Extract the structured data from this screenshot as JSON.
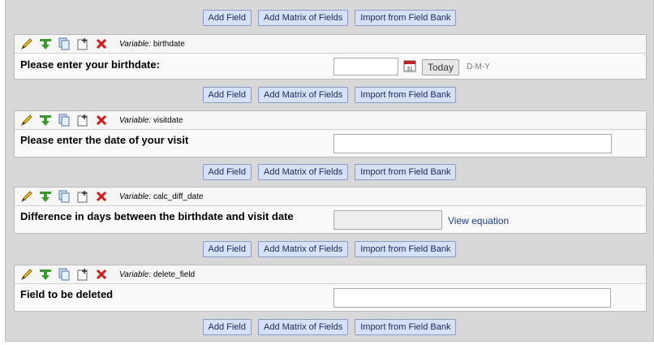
{
  "buttons": {
    "add_field": "Add Field",
    "add_matrix": "Add Matrix of Fields",
    "import_bank": "Import from Field Bank"
  },
  "variable_prefix": "Variable:",
  "fields": [
    {
      "variable": "birthdate",
      "question": "Please enter your birthdate:",
      "today_label": "Today",
      "date_format": "D-M-Y"
    },
    {
      "variable": "visitdate",
      "question": "Please enter the date of your visit"
    },
    {
      "variable": "calc_diff_date",
      "question": "Difference in days between the birthdate and visit date",
      "equation_link": "View equation"
    },
    {
      "variable": "delete_field",
      "question": "Field to be deleted"
    }
  ]
}
